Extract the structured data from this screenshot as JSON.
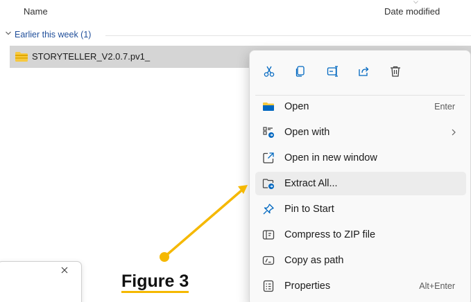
{
  "columns": {
    "name": "Name",
    "date_modified": "Date modified"
  },
  "group": {
    "label": "Earlier this week (1)"
  },
  "file": {
    "name": "STORYTELLER_V2.0.7.pv1_"
  },
  "context_menu": {
    "quick_actions": [
      {
        "id": "cut",
        "icon": "scissors-icon"
      },
      {
        "id": "copy",
        "icon": "copy-icon"
      },
      {
        "id": "rename",
        "icon": "rename-icon"
      },
      {
        "id": "share",
        "icon": "share-icon"
      },
      {
        "id": "delete",
        "icon": "trash-icon"
      }
    ],
    "items": [
      {
        "label": "Open",
        "shortcut": "Enter",
        "icon": "folder-icon"
      },
      {
        "label": "Open with",
        "shortcut": "",
        "icon": "apps-icon",
        "has_submenu": true
      },
      {
        "label": "Open in new window",
        "shortcut": "",
        "icon": "new-window-icon"
      },
      {
        "label": "Extract All...",
        "shortcut": "",
        "icon": "extract-folder-icon",
        "highlighted": true
      },
      {
        "label": "Pin to Start",
        "shortcut": "",
        "icon": "pin-icon"
      },
      {
        "label": "Compress to ZIP file",
        "shortcut": "",
        "icon": "zip-icon"
      },
      {
        "label": "Copy as path",
        "shortcut": "",
        "icon": "path-icon"
      },
      {
        "label": "Properties",
        "shortcut": "Alt+Enter",
        "icon": "properties-icon"
      }
    ]
  },
  "annotation": {
    "label": "Figure 3"
  },
  "colors": {
    "accent": "#1f4e9a",
    "folder": "#f7c940",
    "arrow": "#f5b800",
    "selected_row": "#d5d5d5",
    "icon_blue": "#0067c0"
  }
}
